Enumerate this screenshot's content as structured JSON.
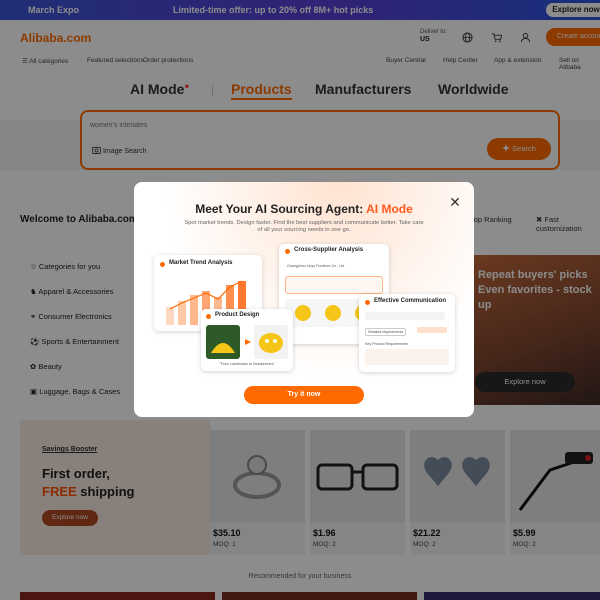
{
  "promo": {
    "brand": "March Expo",
    "offer": "Limited-time offer: up to 20% off 8M+ hot picks",
    "explore": "Explore now"
  },
  "header": {
    "logo": "Alibaba.com",
    "deliver_label": "Deliver to:",
    "deliver_country": "US",
    "create_account": "Create account",
    "subnav": [
      "All categories",
      "Featured selections",
      "Order protections"
    ],
    "right_links": [
      "Buyer Central",
      "Help Center",
      "App & extension",
      "Sell on Alibaba"
    ]
  },
  "tabs": [
    "AI Mode",
    "Products",
    "Manufacturers",
    "Worldwide"
  ],
  "search": {
    "placeholder": "women's intimates",
    "image_search": "Image Search",
    "button": "Search"
  },
  "welcome": "Welcome to Alibaba.com",
  "top_links": [
    "Top Ranking",
    "Fast customization"
  ],
  "categories": [
    "Categories for you",
    "Apparel & Accessories",
    "Consumer Electronics",
    "Sports & Entertainment",
    "Beauty",
    "Luggage, Bags & Cases"
  ],
  "banner": {
    "text": "Repeat buyers' picks Even favorites - stock up",
    "button": "Explore now"
  },
  "booster": {
    "tag": "Savings Booster",
    "line1": "First order,",
    "line2_highlight": "FREE",
    "line2_rest": "shipping",
    "button": "Explore now"
  },
  "products": [
    {
      "price": "$35.10",
      "moq": "MOQ: 1"
    },
    {
      "price": "$1.96",
      "moq": "MOQ: 2"
    },
    {
      "price": "$21.22",
      "moq": "MOQ: 2"
    },
    {
      "price": "$5.99",
      "moq": "MOQ: 2"
    }
  ],
  "recommended": "Recommended for your business",
  "modal": {
    "title_prefix": "Meet Your AI Sourcing Agent:",
    "title_highlight": "AI Mode",
    "subtitle": "Spot market trends. Design faster. Find the best suppliers and communicate better. Take care of all your sourcing needs in one go.",
    "cards": {
      "trend": "Market Trend Analysis",
      "supplier": "Cross-Supplier Analysis",
      "design": "Product Design",
      "comm": "Effective Communication"
    },
    "design_caption": "\"From Landmarks to Headphones\"",
    "supplier_name": "Guangzhou Linyu Furniture Co., Ltd.",
    "comm_tag": "Detailed requirements",
    "comm_field": "Key Product Requirements",
    "button": "Try it now"
  },
  "colors": {
    "accent": "#ff6a00",
    "ai_highlight": "#ff5a1f"
  }
}
